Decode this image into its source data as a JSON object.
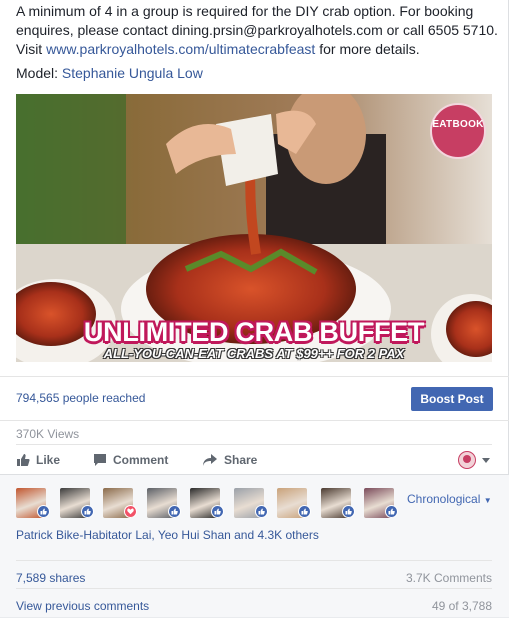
{
  "post": {
    "text_main": "A minimum of 4 in a group is required for the DIY crab option. For booking enquires, please contact dining.prsin@parkroyalhotels.com or call 6505 5710. Visit ",
    "link": "www.parkroyalhotels.com/ultimatecrabfeast",
    "text_tail": " for more details.",
    "model_label": "Model: ",
    "model_name": "Stephanie Ungula Low"
  },
  "media": {
    "badge": "EATBOOK",
    "headline": "UNLIMITED CRAB BUFFET",
    "subline": "ALL-YOU-CAN-EAT CRABS AT $99++ FOR 2 PAX"
  },
  "insights": {
    "reach": "794,565 people reached",
    "boost_label": "Boost Post",
    "views": "370K Views"
  },
  "actions": {
    "like": "Like",
    "comment": "Comment",
    "share": "Share"
  },
  "likers": {
    "chronological": "Chronological",
    "summary": "Patrick Bike-Habitator Lai, Yeo Hui Shan and 4.3K others",
    "avatars": [
      {
        "reaction": "like",
        "color": "#c1562f"
      },
      {
        "reaction": "like",
        "color": "#3b3b3b"
      },
      {
        "reaction": "love",
        "color": "#8a6a4a"
      },
      {
        "reaction": "like",
        "color": "#5b5f66"
      },
      {
        "reaction": "like",
        "color": "#2a2a2a"
      },
      {
        "reaction": "like",
        "color": "#9aa0a8"
      },
      {
        "reaction": "like",
        "color": "#c9a27a"
      },
      {
        "reaction": "like",
        "color": "#4a3a30"
      },
      {
        "reaction": "like",
        "color": "#7a4a5a"
      }
    ]
  },
  "stats": {
    "shares": "7,589 shares",
    "comments": "3.7K Comments",
    "view_previous": "View previous comments",
    "page_count": "49 of 3,788"
  },
  "colors": {
    "link": "#365899",
    "boost": "#4267b2",
    "like_badge": "#4267b2",
    "love_badge": "#f25268",
    "headline_stroke": "#c0185b"
  }
}
